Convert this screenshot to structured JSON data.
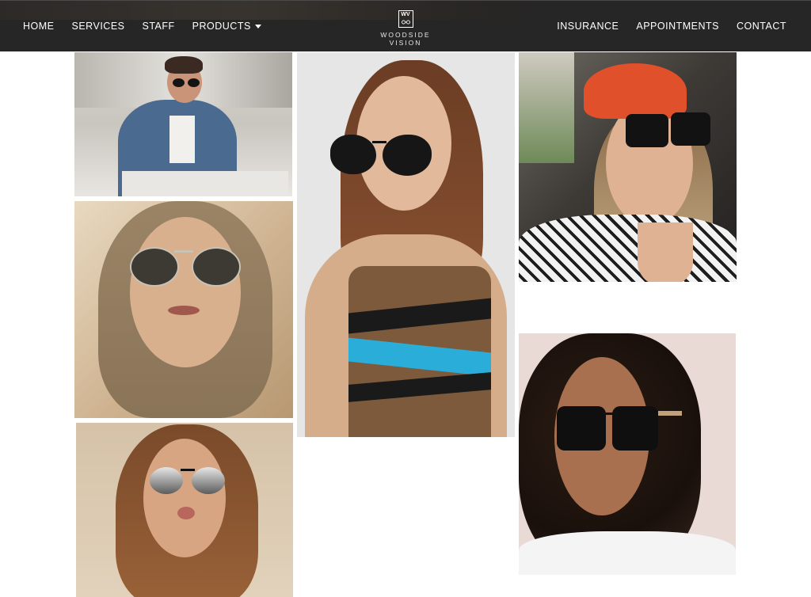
{
  "brand": {
    "name": "WOODSIDE VISION",
    "mark": "WV"
  },
  "nav": {
    "left": [
      {
        "label": "HOME"
      },
      {
        "label": "SERVICES"
      },
      {
        "label": "STAFF"
      },
      {
        "label": "PRODUCTS",
        "dropdown": true
      }
    ],
    "right": [
      {
        "label": "INSURANCE"
      },
      {
        "label": "APPOINTMENTS"
      },
      {
        "label": "CONTACT"
      }
    ]
  },
  "gallery": {
    "photos": [
      {
        "subject": "man in denim shirt wearing dark sunglasses, seated in cafe"
      },
      {
        "subject": "woman with long hair wearing aviator sunglasses"
      },
      {
        "subject": "woman with brown hair wearing mirrored aviator sunglasses"
      },
      {
        "subject": "woman in knit top wearing black cat-eye sunglasses"
      },
      {
        "subject": "woman in red cap wearing oversized square sunglasses"
      },
      {
        "subject": "woman with curly hair wearing square dark sunglasses"
      }
    ]
  },
  "colors": {
    "navbar": "#262626",
    "nav_text": "#ffffff",
    "page_background": "#ffffff"
  }
}
